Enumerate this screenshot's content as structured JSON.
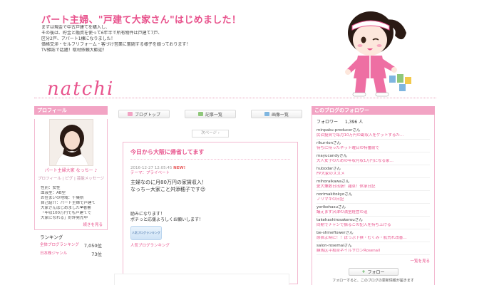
{
  "header": {
    "title": "パート主婦、\"戸建て大家さん\"はじめました！",
    "intro_lines": [
      "まずは現金で中古戸建てを購入し、",
      "その後は、貯金と融資を使って6年半で所有物件は戸建て7戸、",
      "区分2戸、アパート1棟になりました！",
      "価格交渉・セルフリフォーム・客づけ営業に奮闘する様子を綴っております！",
      "TV雑誌で話題！取材依頼大歓迎！"
    ],
    "brand": "natchi"
  },
  "profile": {
    "heading": "プロフィール",
    "name": "パート主婦大家 なっちー ♪",
    "links": "プロフィール | ピグ | 芸能メッセージ",
    "meta_lines": [
      "性別：女性",
      "血液型：AB型",
      "お住まいの地域：千葉県",
      "自己紹介：パート主婦で戸建て",
      "大家さんはじめました❤著書",
      "「年収100万円でも戸建てで",
      "大家になれる」好評発売中"
    ],
    "more": "続きを見る",
    "ranking_title": "ランキング",
    "rankings": [
      {
        "label": "全体ブログランキング",
        "value": "7,050位"
      },
      {
        "label": "日本株ジャンル",
        "value": "73位"
      }
    ]
  },
  "tabs": [
    {
      "label": "ブログトップ",
      "color": "#f2a4c4"
    },
    {
      "label": "記事一覧",
      "color": "#8fc77a"
    },
    {
      "label": "画像一覧",
      "color": "#7fb6e0"
    }
  ],
  "next_page": "次ページ ›",
  "post": {
    "title": "今日から大阪に帰省してます",
    "date": "2016-12-27 12:05:45",
    "new_label": "NEW!",
    "theme": "テーマ：プライベート",
    "body_lines": [
      "主婦なのに月80万円の家賃収入！",
      "なっちー大家こと舛添穂子です☺"
    ],
    "cheer_lines": [
      "励みになります！",
      "ポチっと応援よろしくお願いします！"
    ],
    "badge_text": "人気ブログランキング",
    "link_text": "人気ブログランキング"
  },
  "followers": {
    "heading": "このブログのフォロワー",
    "count_label": "フォロワー",
    "count_value": "1,396 人",
    "items": [
      {
        "name": "minpaku-producerさん",
        "text": "民泊投資で毎月10万円の副収入をゲットするた…"
      },
      {
        "name": "rikurrionさん",
        "text": "待ちに待ったネット曜日の特番前で"
      },
      {
        "name": "mayucandyさん",
        "text": "大人女子のための年収月収1万円になる家…"
      },
      {
        "name": "hubodarさん",
        "text": "FP大家のススメ"
      },
      {
        "name": "mihoraikawaさん",
        "text": "愛犬兼数日出張！雑草！休承日記"
      },
      {
        "name": "norimakitokyoさん",
        "text": "ノリマキの日記"
      },
      {
        "name": "yorikohasuさん",
        "text": "議えます沢津の満室経営の道"
      },
      {
        "name": "takehashirosakerouさん",
        "text": "同期でチャンで振るこの記入を持ち上げる"
      },
      {
        "name": "be-shineflowerさん",
        "text": "原宿よ時に！！ぽっぷ下挟・むくみ・肌荒れ改善…"
      },
      {
        "name": "salon-rosemaiさん",
        "text": "練馬区平和台ネイルサロンRosenail"
      }
    ],
    "more": "一覧を見る",
    "follow_button": "フォロー",
    "note": "フォローすると、このブログの更新情報が届きます"
  }
}
